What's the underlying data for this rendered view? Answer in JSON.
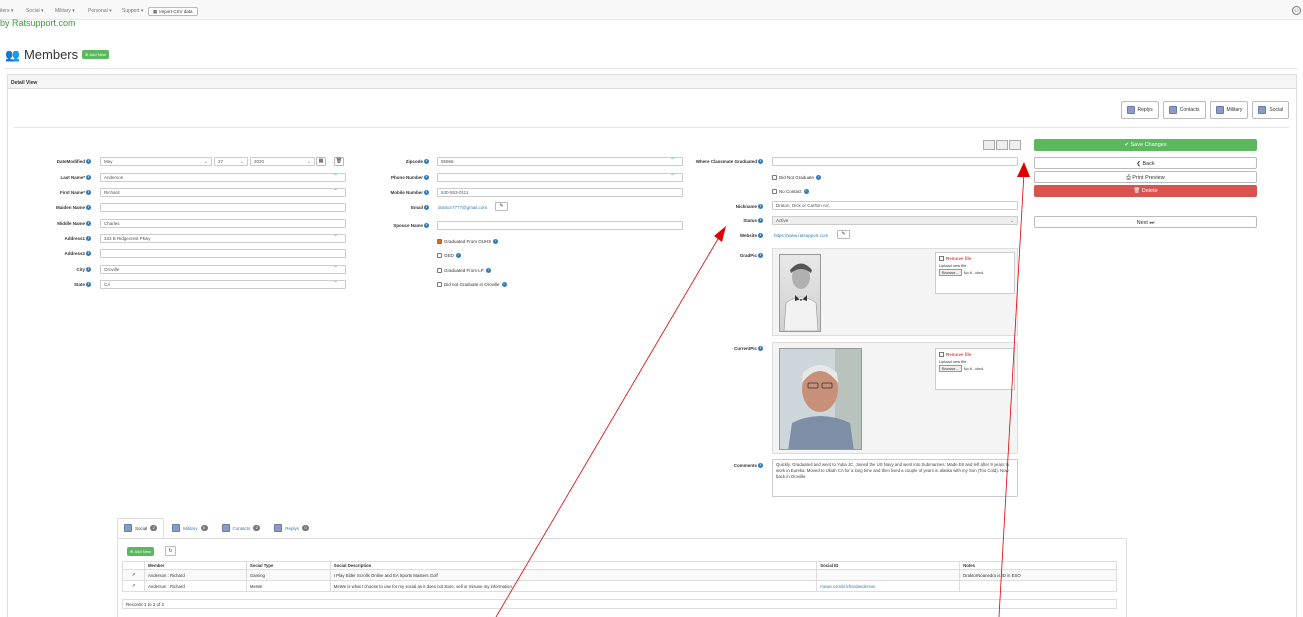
{
  "nav": {
    "menus": [
      "iters ▾",
      "Social ▾",
      "Military ▾",
      "Personal ▾",
      "Support ▾"
    ],
    "import_label": "Import CSV data",
    "site_link": "by Ratsupport.com"
  },
  "header": {
    "title": "Members",
    "add_new": "Add New"
  },
  "panel": {
    "heading": "Detail View",
    "top_tabs": [
      "Replys",
      "Contacts",
      "Military",
      "Social"
    ]
  },
  "form": {
    "date_modified": {
      "label": "DateModified",
      "month": "May",
      "day": "27",
      "year": "2020"
    },
    "last_name": {
      "label": "Last Name*",
      "value": "Anderson"
    },
    "first_name": {
      "label": "First Name*",
      "value": "Richard"
    },
    "maiden_name": {
      "label": "Maiden Name",
      "value": ""
    },
    "middle_name": {
      "label": "Middle Name",
      "value": "Charles"
    },
    "address1": {
      "label": "Address1",
      "value": "333 B Ridgecrest Pkwy"
    },
    "address2": {
      "label": "Address2",
      "value": ""
    },
    "city": {
      "label": "City",
      "value": "Oroville"
    },
    "state": {
      "label": "State",
      "value": "CA"
    },
    "zipcode": {
      "label": "Zipcode",
      "value": "95966"
    },
    "phone": {
      "label": "Phone Number",
      "value": ""
    },
    "mobile": {
      "label": "Mobile Number",
      "value": "530-553-0111"
    },
    "email": {
      "label": "Email",
      "value": "dratsor7777@gmail.com"
    },
    "spouse": {
      "label": "Spouce Name",
      "value": ""
    },
    "checks_mid": [
      {
        "label": "Graduated From OUHS",
        "checked": true
      },
      {
        "label": "GED",
        "checked": false
      },
      {
        "label": "Graduated From LP",
        "checked": false
      },
      {
        "label": "Did not Graduate in Oroville",
        "checked": false
      }
    ],
    "where_graduated": {
      "label": "Where Classmate Graduated",
      "value": ""
    },
    "did_not_graduate": "Did Not Graduate",
    "no_contact": "No Contact",
    "nickname": {
      "label": "Nickname",
      "value": "Draton, Dick or Carlton Arc"
    },
    "status": {
      "label": "Status",
      "value": "Active"
    },
    "website": {
      "label": "Website",
      "value": "https://www.ratsupport.com"
    },
    "grad_pic": {
      "label": "GradPic"
    },
    "current_pic": {
      "label": "CurrentPic"
    },
    "upload": {
      "remove": "Remove file",
      "upload_new": "Upload new file",
      "browse": "Browse...",
      "no_file": "No fi...cted."
    },
    "comments": {
      "label": "Comments",
      "value": "Quickly. Graduated and went to Yuba JC.  Joined the US Navy and went into Submarines. Made E6 and left after 9 years to work in Eureka.  Moved to Ukiah CA for a long time and then lived a couple of years in alaska with my Son (Too Cold).  Now back in Oroville."
    }
  },
  "actions": {
    "save": "Save Changes",
    "back": "Back",
    "print": "Print Preview",
    "delete": "Delete",
    "next": "Next"
  },
  "bottom_tabs": [
    {
      "label": "Social",
      "count": "2"
    },
    {
      "label": "Military",
      "count": "0"
    },
    {
      "label": "Contacts",
      "count": "2"
    },
    {
      "label": "Replys",
      "count": "0"
    }
  ],
  "social_table": {
    "add_new": "Add New",
    "headers": [
      "",
      "Member",
      "Social Type",
      "Social Description",
      "Social ID",
      "Notes"
    ],
    "rows": [
      [
        "",
        "Anderson : Richard",
        "Gaming",
        "I Play Elder Scrolls Online and EA Sports Masters Golf",
        "",
        "DraktorNoanedra is ID in ESO"
      ],
      [
        "",
        "Anderson : Richard",
        "MeWe",
        "MeWe is what I choose to use for my social as it does not store, sell or misuse my information.",
        "mewe.com/i/richardanderson",
        ""
      ]
    ],
    "records": "Records 1 to 2 of 2"
  },
  "colors": {
    "green": "#5cb85c",
    "red": "#d9534f",
    "link": "#337ab7",
    "arrow": "#e00000"
  }
}
